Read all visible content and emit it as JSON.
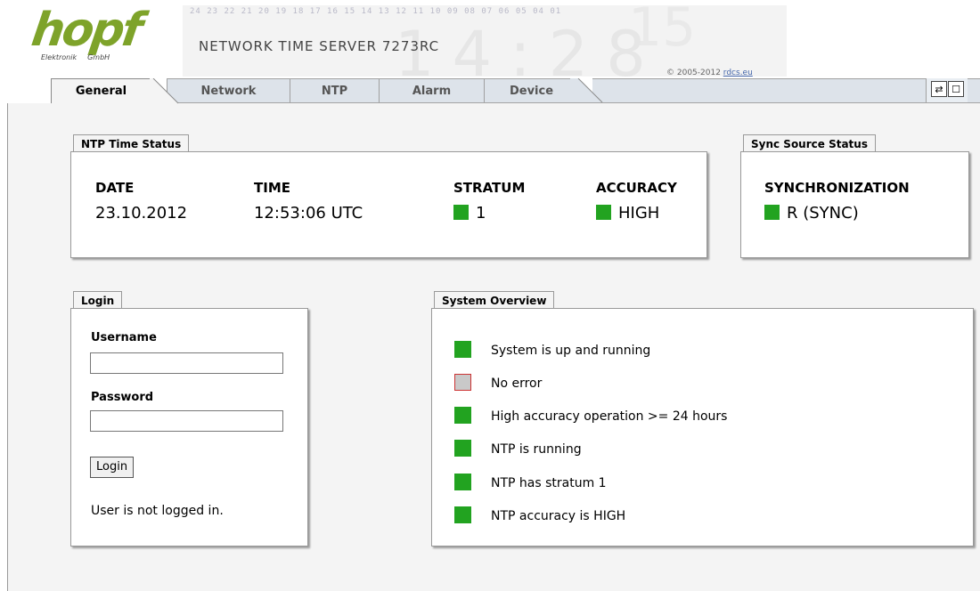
{
  "header": {
    "brand": "hopf",
    "brand_sub_left": "Elektronik",
    "brand_sub_right": "GmbH",
    "banner_digits": "24 23 22 21 20 19 18 17 16 15 14 13 12 11 10 09 08 07 06 05 04 01",
    "banner_bigtime": "14:28",
    "banner_big15": "15",
    "title": "NETWORK TIME SERVER 7273RC",
    "copyright": "© 2005-2012",
    "copyright_link": "rdcs.eu"
  },
  "tabs": [
    {
      "label": "General",
      "active": true
    },
    {
      "label": "Network",
      "active": false
    },
    {
      "label": "NTP",
      "active": false
    },
    {
      "label": "Alarm",
      "active": false
    },
    {
      "label": "Device",
      "active": false
    }
  ],
  "tab_icons": {
    "refresh": "⇄",
    "window": "☐"
  },
  "ntp_status": {
    "label": "NTP Time Status",
    "date_h": "DATE",
    "date_v": "23.10.2012",
    "time_h": "TIME",
    "time_v": "12:53:06 UTC",
    "stratum_h": "STRATUM",
    "stratum_v": "1",
    "accuracy_h": "ACCURACY",
    "accuracy_v": "HIGH"
  },
  "sync_status": {
    "label": "Sync Source Status",
    "sync_h": "SYNCHRONIZATION",
    "sync_v": "R (SYNC)"
  },
  "login": {
    "label": "Login",
    "username_label": "Username",
    "username_value": "",
    "password_label": "Password",
    "password_value": "",
    "button": "Login",
    "status": "User is not logged in."
  },
  "overview": {
    "label": "System Overview",
    "items": [
      {
        "text": "System is up and running",
        "status": "green"
      },
      {
        "text": "No error",
        "status": "gray"
      },
      {
        "text": "High accuracy operation >= 24 hours",
        "status": "green"
      },
      {
        "text": "NTP is running",
        "status": "green"
      },
      {
        "text": "NTP has stratum 1",
        "status": "green"
      },
      {
        "text": "NTP accuracy is HIGH",
        "status": "green"
      }
    ]
  },
  "colors": {
    "accent_green": "#22a320",
    "logo_green": "#7ea32a",
    "error_gray": "#c9c9c9"
  }
}
